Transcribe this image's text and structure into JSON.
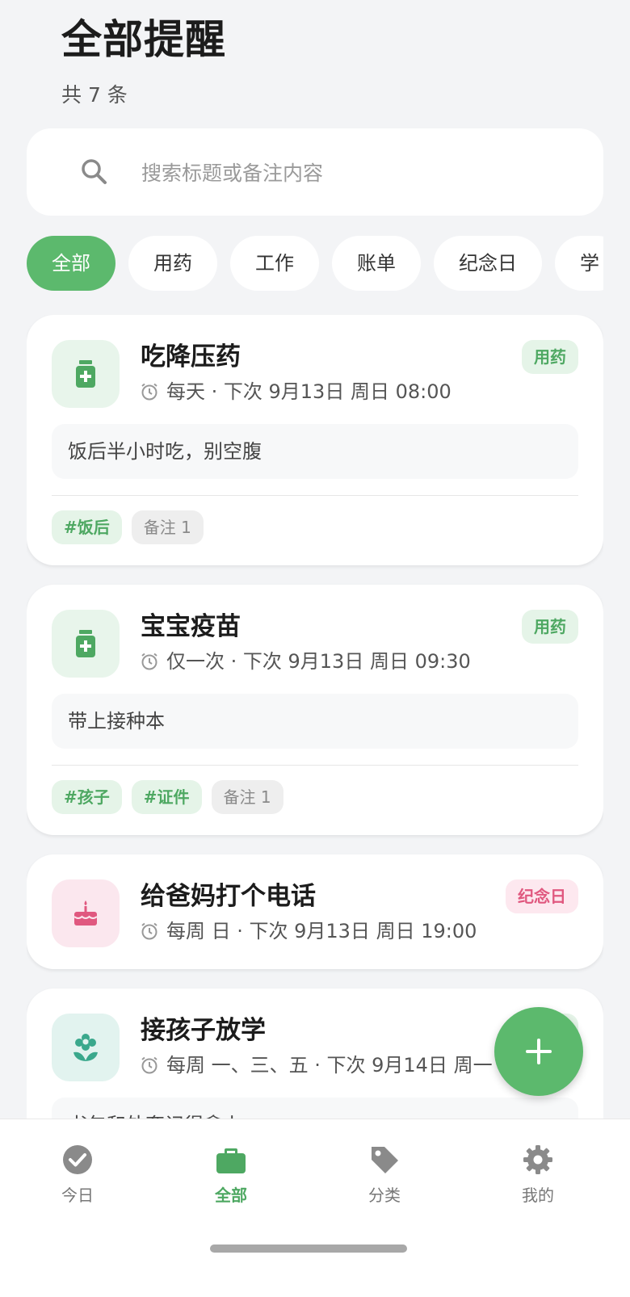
{
  "header": {
    "title": "全部提醒",
    "count_text": "共 7 条"
  },
  "search": {
    "placeholder": "搜索标题或备注内容"
  },
  "categories": [
    "全部",
    "用药",
    "工作",
    "账单",
    "纪念日",
    "学"
  ],
  "reminders": [
    {
      "title": "吃降压药",
      "schedule": "每天 · 下次 9月13日 周日 08:00",
      "category": "用药",
      "icon": "medicine-icon",
      "note": "饭后半小时吃，别空腹",
      "tags": [
        "#饭后"
      ],
      "note_count": "备注 1"
    },
    {
      "title": "宝宝疫苗",
      "schedule": "仅一次 · 下次 9月13日 周日 09:30",
      "category": "用药",
      "icon": "medicine-icon",
      "note": "带上接种本",
      "tags": [
        "#孩子",
        "#证件"
      ],
      "note_count": "备注 1"
    },
    {
      "title": "给爸妈打个电话",
      "schedule": "每周 日 · 下次 9月13日 周日 19:00",
      "category": "纪念日",
      "icon": "cake-icon"
    },
    {
      "title": "接孩子放学",
      "schedule": "每周 一、三、五 · 下次 9月14日 周一",
      "category": "",
      "icon": "flower-icon",
      "note": "书包和外套记得拿上"
    }
  ],
  "nav": [
    {
      "label": "今日",
      "icon": "check-circle-icon"
    },
    {
      "label": "全部",
      "icon": "briefcase-icon"
    },
    {
      "label": "分类",
      "icon": "tag-icon"
    },
    {
      "label": "我的",
      "icon": "gear-icon"
    }
  ],
  "colors": {
    "accent": "#5cb96d",
    "medicine_badge_bg": "#e5f4e8",
    "anniversary_badge_bg": "#fde8ef",
    "anniversary_text": "#e0587f"
  }
}
